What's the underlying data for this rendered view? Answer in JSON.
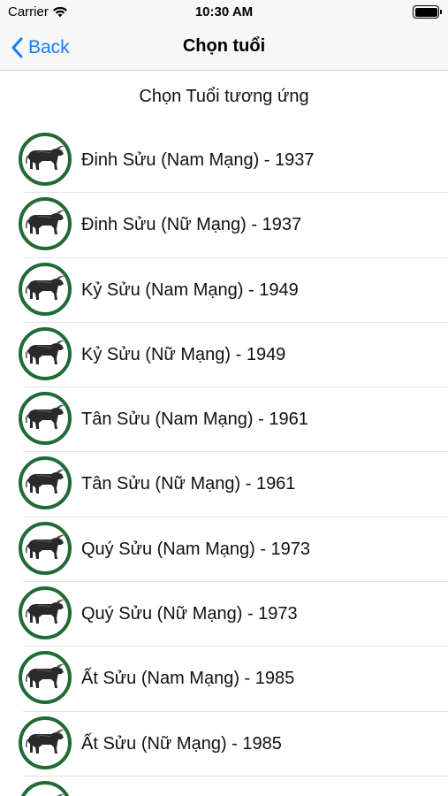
{
  "status_bar": {
    "carrier": "Carrier",
    "time": "10:30 AM"
  },
  "nav": {
    "back_label": "Back",
    "title": "Chọn tuổi"
  },
  "section_header": "Chọn Tuổi tương ứng",
  "items": [
    {
      "label": "Đinh Sửu (Nam Mạng) - 1937"
    },
    {
      "label": "Đinh Sửu (Nữ Mạng) - 1937"
    },
    {
      "label": "Kỷ Sửu (Nam Mạng) - 1949"
    },
    {
      "label": "Kỷ Sửu (Nữ Mạng) - 1949"
    },
    {
      "label": "Tân Sửu (Nam Mạng) - 1961"
    },
    {
      "label": "Tân Sửu (Nữ Mạng) - 1961"
    },
    {
      "label": "Quý Sửu (Nam Mạng) - 1973"
    },
    {
      "label": "Quý Sửu (Nữ Mạng) - 1973"
    },
    {
      "label": "Ất Sửu (Nam Mạng) - 1985"
    },
    {
      "label": "Ất Sửu (Nữ Mạng) - 1985"
    }
  ],
  "colors": {
    "accent": "#147efb",
    "avatar_ring": "#1f6b35"
  },
  "icons": {
    "row_avatar": "buffalo-icon",
    "back": "chevron-left-icon",
    "signal": "wifi-icon",
    "battery": "battery-icon"
  }
}
